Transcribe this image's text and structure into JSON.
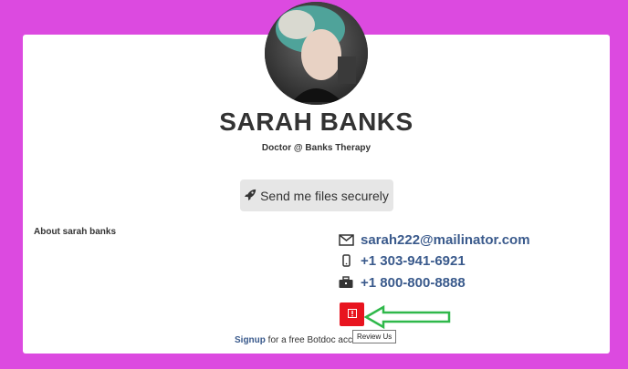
{
  "profile": {
    "name": "SARAH BANKS",
    "subtitle": "Doctor @ Banks Therapy",
    "send_button_label": "Send me files securely",
    "about_label": "About sarah banks"
  },
  "contact": {
    "email": "sarah222@mailinator.com",
    "mobile": "+1 303-941-6921",
    "office": "+1 800-800-8888"
  },
  "review": {
    "tooltip": "Review Us"
  },
  "footer": {
    "signup_link": "Signup",
    "signup_text": "for a free Botdoc acc"
  },
  "colors": {
    "background": "#dc4ae0",
    "link": "#3a5a8c",
    "review_button": "#e8141f",
    "annotation_arrow": "#2fb84a"
  },
  "icons": {
    "send": "rocket-icon",
    "email": "envelope-icon",
    "mobile": "mobile-phone-icon",
    "office": "briefcase-icon",
    "review": "exclamation-icon"
  }
}
